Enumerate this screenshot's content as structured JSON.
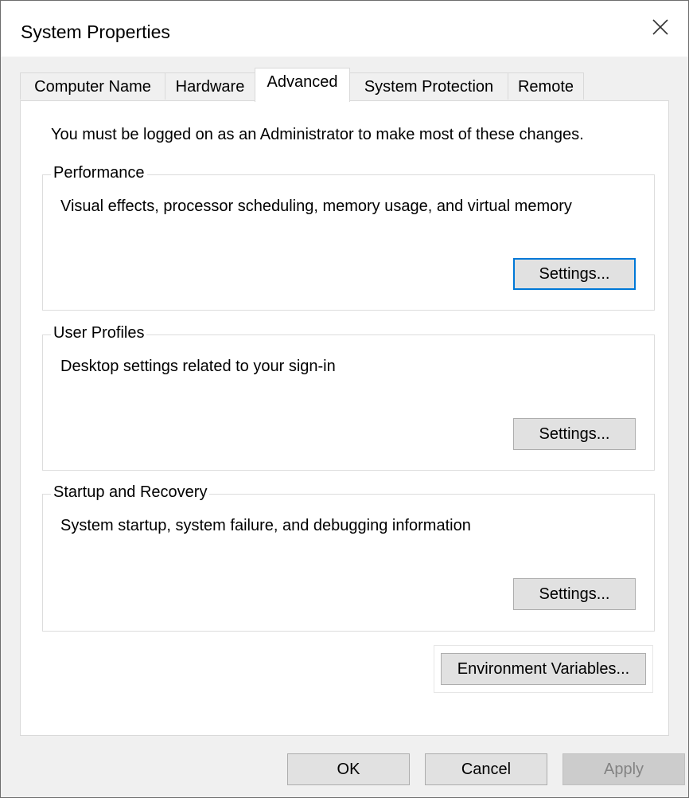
{
  "window": {
    "title": "System Properties",
    "close_icon": "close-icon"
  },
  "tabs": [
    {
      "label": "Computer Name",
      "active": false
    },
    {
      "label": "Hardware",
      "active": false
    },
    {
      "label": "Advanced",
      "active": true
    },
    {
      "label": "System Protection",
      "active": false
    },
    {
      "label": "Remote",
      "active": false
    }
  ],
  "advanced": {
    "admin_note": "You must be logged on as an Administrator to make most of these changes.",
    "performance": {
      "label": "Performance",
      "description": "Visual effects, processor scheduling, memory usage, and virtual memory",
      "button": "Settings..."
    },
    "user_profiles": {
      "label": "User Profiles",
      "description": "Desktop settings related to your sign-in",
      "button": "Settings..."
    },
    "startup_recovery": {
      "label": "Startup and Recovery",
      "description": "System startup, system failure, and debugging information",
      "button": "Settings..."
    },
    "env_button": "Environment Variables..."
  },
  "footer": {
    "ok": "OK",
    "cancel": "Cancel",
    "apply": "Apply"
  },
  "colors": {
    "focus_accent": "#0078d7",
    "button_face": "#e1e1e1",
    "dialog_bg": "#f0f0f0"
  }
}
